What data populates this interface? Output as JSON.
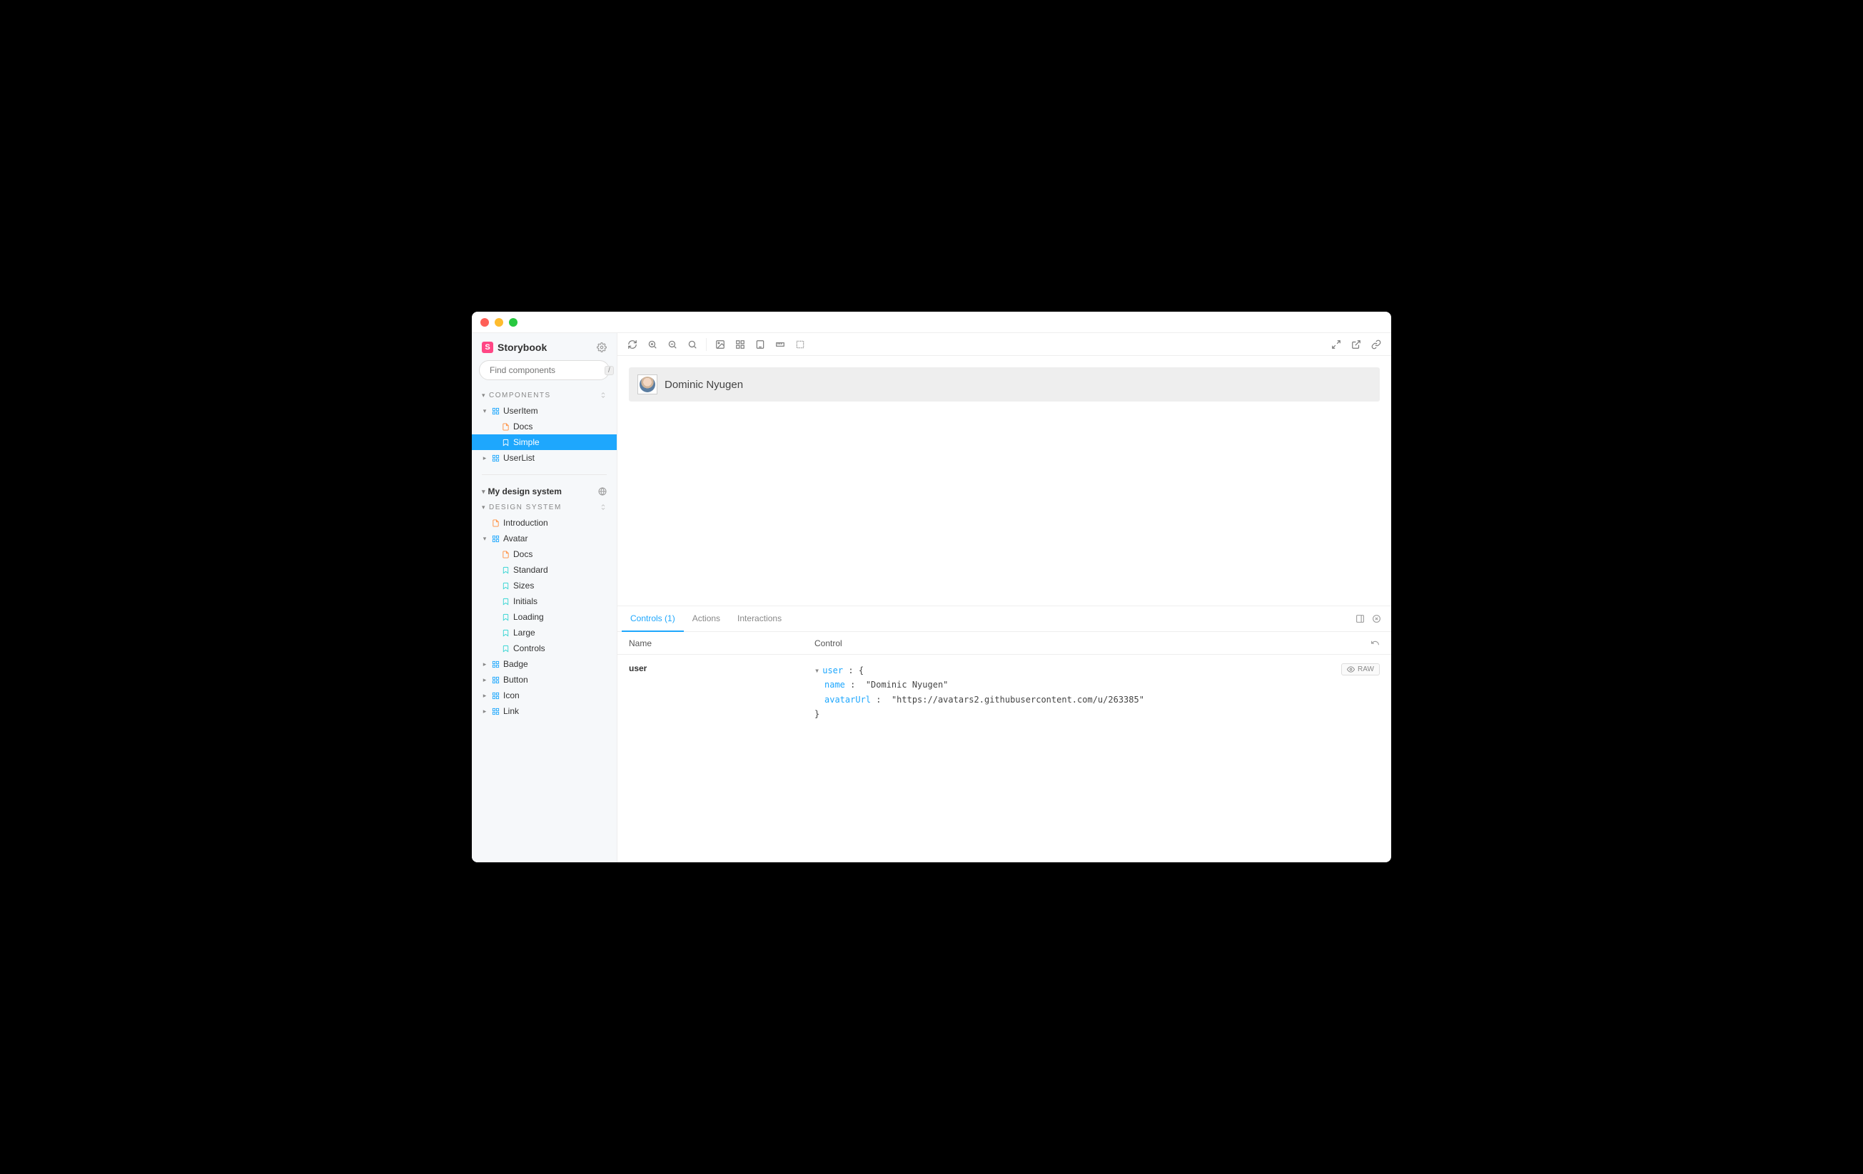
{
  "brand": {
    "name": "Storybook",
    "logoLetter": "S"
  },
  "search": {
    "placeholder": "Find components",
    "shortcut": "/"
  },
  "sidebar": {
    "sections": [
      {
        "title": "COMPONENTS",
        "items": [
          {
            "label": "UserItem",
            "kind": "component",
            "depth": 0,
            "collapsed": false
          },
          {
            "label": "Docs",
            "kind": "doc",
            "depth": 1
          },
          {
            "label": "Simple",
            "kind": "story",
            "depth": 1,
            "selected": true
          },
          {
            "label": "UserList",
            "kind": "component",
            "depth": 0,
            "collapsed": true
          }
        ]
      },
      {
        "title": "My design system",
        "kind": "heading-bold",
        "iconRight": "globe"
      },
      {
        "title": "DESIGN SYSTEM",
        "items": [
          {
            "label": "Introduction",
            "kind": "doc",
            "depth": 0
          },
          {
            "label": "Avatar",
            "kind": "component",
            "depth": 0,
            "collapsed": false
          },
          {
            "label": "Docs",
            "kind": "doc",
            "depth": 1
          },
          {
            "label": "Standard",
            "kind": "story",
            "depth": 1
          },
          {
            "label": "Sizes",
            "kind": "story",
            "depth": 1
          },
          {
            "label": "Initials",
            "kind": "story",
            "depth": 1
          },
          {
            "label": "Loading",
            "kind": "story",
            "depth": 1
          },
          {
            "label": "Large",
            "kind": "story",
            "depth": 1
          },
          {
            "label": "Controls",
            "kind": "story",
            "depth": 1
          },
          {
            "label": "Badge",
            "kind": "component",
            "depth": 0,
            "collapsed": true
          },
          {
            "label": "Button",
            "kind": "component",
            "depth": 0,
            "collapsed": true
          },
          {
            "label": "Icon",
            "kind": "component",
            "depth": 0,
            "collapsed": true
          },
          {
            "label": "Link",
            "kind": "component",
            "depth": 0,
            "collapsed": true
          }
        ]
      }
    ]
  },
  "preview": {
    "userName": "Dominic Nyugen"
  },
  "addons": {
    "tabs": [
      {
        "label": "Controls (1)",
        "active": true
      },
      {
        "label": "Actions"
      },
      {
        "label": "Interactions"
      }
    ],
    "headers": {
      "name": "Name",
      "control": "Control"
    },
    "rows": [
      {
        "name": "user",
        "object": {
          "rootKey": "user",
          "fields": [
            {
              "key": "name",
              "value": "\"Dominic Nyugen\""
            },
            {
              "key": "avatarUrl",
              "value": "\"https://avatars2.githubusercontent.com/u/263385\""
            }
          ]
        }
      }
    ],
    "rawLabel": "RAW"
  }
}
